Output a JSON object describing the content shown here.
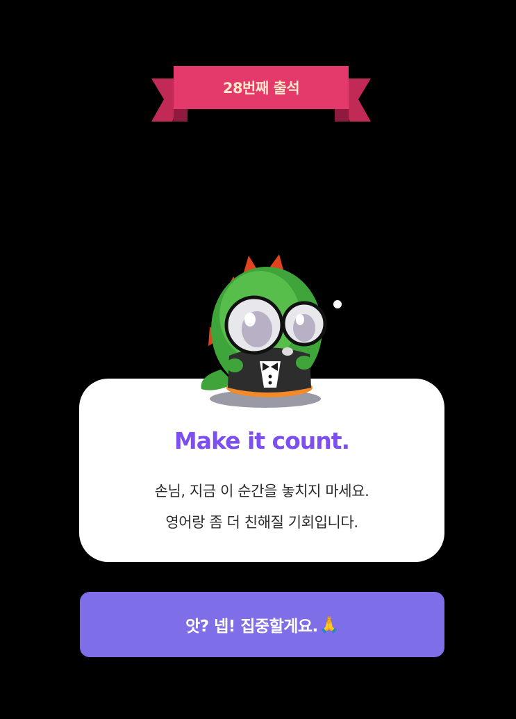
{
  "badge": {
    "label": "28번째 출석",
    "color": "#e33a6b"
  },
  "mascot": {
    "name": "green-dinosaur-mascot"
  },
  "card": {
    "title": "Make it count.",
    "line1": "손님, 지금 이 순간을 놓치지 마세요.",
    "line2": "영어랑 좀 더 친해질 기회입니다."
  },
  "button": {
    "label": "앗? 넵! 집중할게요.",
    "emoji": "🙏",
    "color": "#7e6ee8"
  },
  "colors": {
    "background": "#000000",
    "accent": "#7e4ff0"
  }
}
